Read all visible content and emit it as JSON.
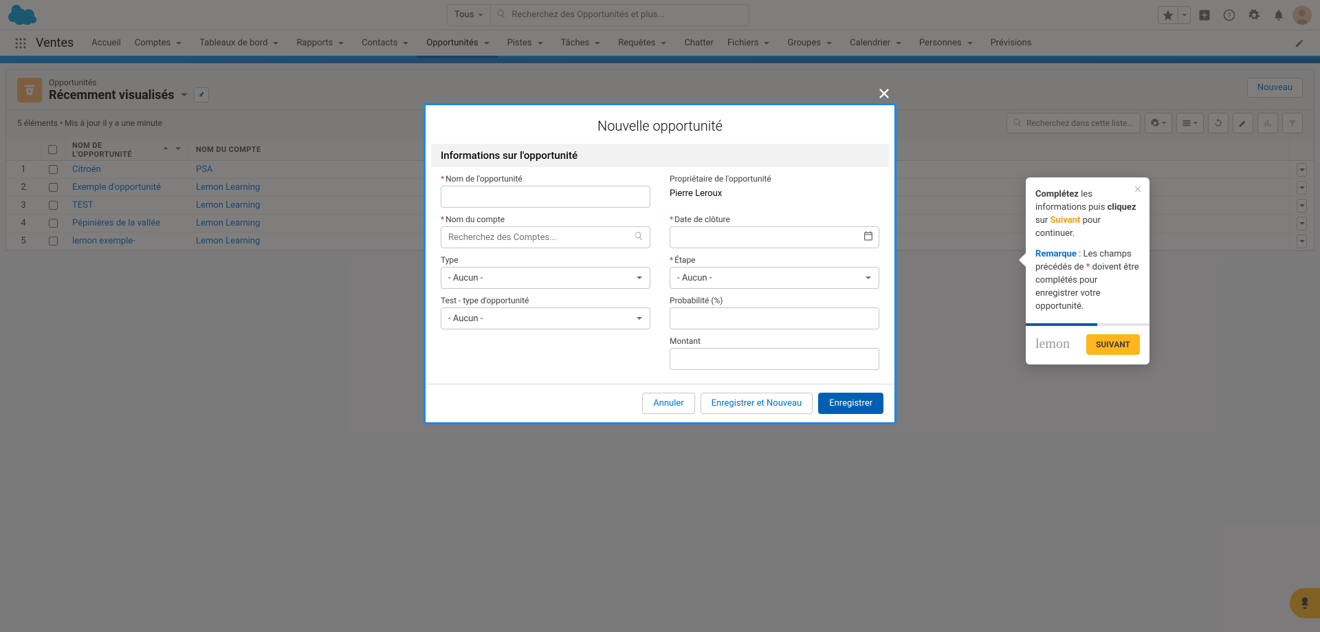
{
  "header": {
    "search_scope": "Tous",
    "search_placeholder": "Recherchez des Opportunités et plus..."
  },
  "app": {
    "name": "Ventes",
    "tabs": [
      "Accueil",
      "Comptes",
      "Tableaux de bord",
      "Rapports",
      "Contacts",
      "Opportunités",
      "Pistes",
      "Tâches",
      "Requêtes",
      "Chatter",
      "Fichiers",
      "Groupes",
      "Calendrier",
      "Personnes",
      "Prévisions"
    ],
    "active_tab_index": 5
  },
  "list": {
    "object_label": "Opportunités",
    "view_name": "Récemment visualisés",
    "new_button": "Nouveau",
    "status": "5 éléments • Mis à jour il y a une minute",
    "search_placeholder": "Recherchez dans cette liste...",
    "columns": {
      "name": "NOM DE L'OPPORTUNITÉ",
      "account": "NOM DU COMPTE"
    },
    "rows": [
      {
        "n": "1",
        "name": "Citroën",
        "account": "PSA"
      },
      {
        "n": "2",
        "name": "Exemple d'opportunité",
        "account": "Lemon Learning"
      },
      {
        "n": "3",
        "name": "TEST",
        "account": "Lemon Learning"
      },
      {
        "n": "4",
        "name": "Pépinières de la vallée",
        "account": "Lemon Learning"
      },
      {
        "n": "5",
        "name": "lemon exemple-",
        "account": "Lemon Learning"
      }
    ]
  },
  "modal": {
    "title": "Nouvelle opportunité",
    "section_title": "Informations sur l'opportunité",
    "fields": {
      "opp_name": "Nom de l'opportunité",
      "owner_label": "Propriétaire de l'opportunité",
      "owner_value": "Pierre Leroux",
      "account": "Nom du compte",
      "account_placeholder": "Recherchez des Comptes...",
      "close_date": "Date de clôture",
      "type": "Type",
      "stage": "Étape",
      "test_type": "Test - type d'opportunité",
      "probability": "Probabilité (%)",
      "amount": "Montant",
      "none_option": "- Aucun -"
    },
    "buttons": {
      "cancel": "Annuler",
      "save_new": "Enregistrer et Nouveau",
      "save": "Enregistrer"
    }
  },
  "popover": {
    "completez": "Complétez",
    "line1_rest": " les informations puis ",
    "cliquez": "cliquez",
    "sur": " sur ",
    "suivant": "Suivant",
    "line1_end": " pour continuer.",
    "remarque": "Remarque",
    "line2_a": " : Les champs précédés de ",
    "star": "*",
    "line2_b": " doivent être complétés pour enregistrer votre opportunité.",
    "next_button": "SUIVANT",
    "logo_text": "lemon"
  }
}
